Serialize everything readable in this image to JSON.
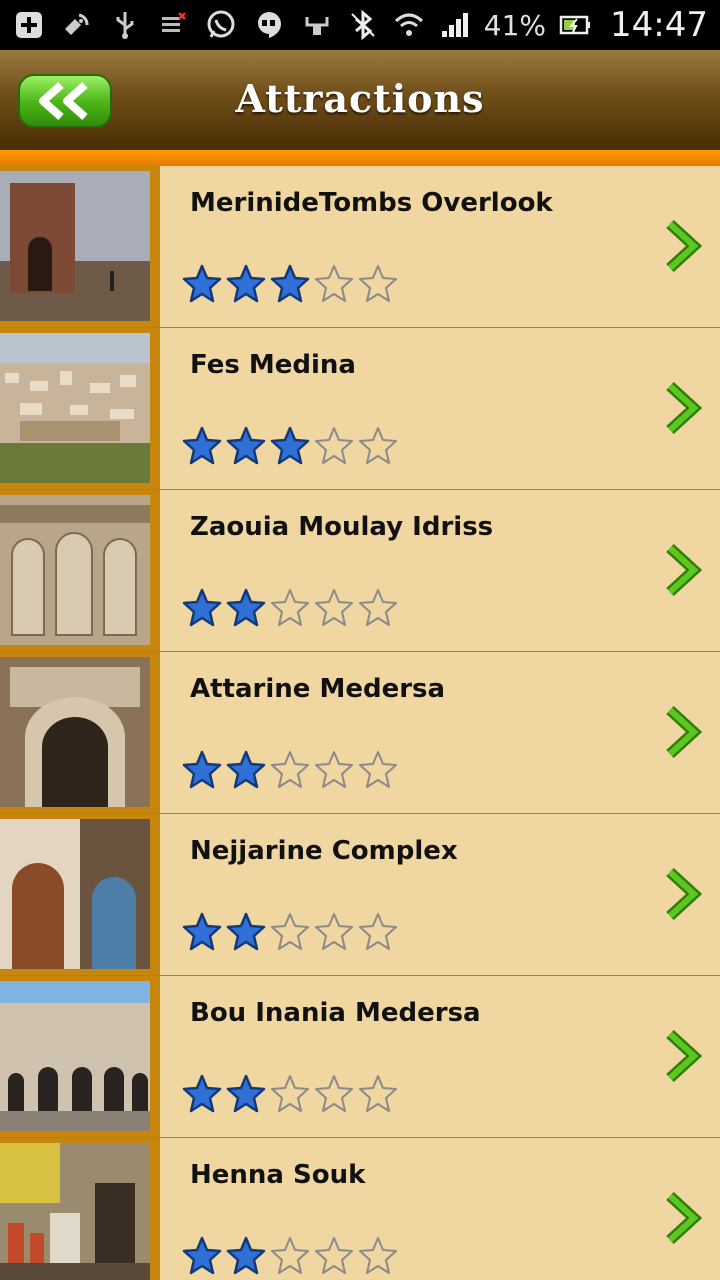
{
  "status_bar": {
    "battery_percent": "41%",
    "time": "14:47",
    "left_icons": [
      "plus-icon",
      "gps-icon",
      "usb-icon",
      "data-icon",
      "whatsapp-icon",
      "hangouts-icon"
    ],
    "right_icons": [
      "sync-icon",
      "bluetooth-icon",
      "wifi-icon",
      "signal-icon",
      "battery-icon"
    ]
  },
  "header": {
    "title": "Attractions",
    "back_button_icon": "double-chevron-left-icon"
  },
  "colors": {
    "header_top": "#9a7a3f",
    "header_bottom": "#4a2d05",
    "accent_bar": "#ff9c00",
    "row_background": "#f0d6a0",
    "thumb_frame": "#c7860d",
    "star_filled": "#2f6fd6",
    "chevron": "#4cb51a"
  },
  "attractions": [
    {
      "name": "MerinideTombs Overlook",
      "rating": 3,
      "max_rating": 5
    },
    {
      "name": "Fes Medina",
      "rating": 3,
      "max_rating": 5
    },
    {
      "name": "Zaouia Moulay Idriss",
      "rating": 2,
      "max_rating": 5
    },
    {
      "name": "Attarine Medersa",
      "rating": 2,
      "max_rating": 5
    },
    {
      "name": "Nejjarine Complex",
      "rating": 2,
      "max_rating": 5
    },
    {
      "name": "Bou Inania Medersa",
      "rating": 2,
      "max_rating": 5
    },
    {
      "name": "Henna Souk",
      "rating": 2,
      "max_rating": 5
    }
  ]
}
